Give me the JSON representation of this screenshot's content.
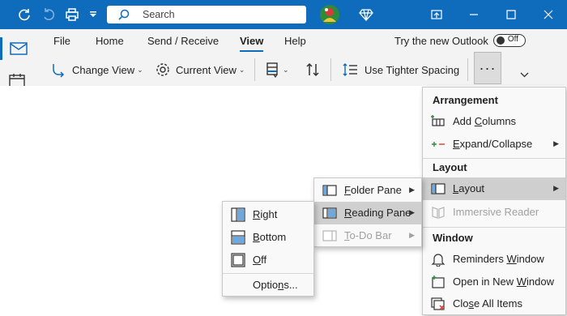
{
  "search": {
    "label": "Search"
  },
  "ribbon": {
    "tabs": [
      "File",
      "Home",
      "Send / Receive",
      "View",
      "Help"
    ],
    "active_tab": "View",
    "try_new": "Try the new Outlook",
    "toggle_state": "Off",
    "change_view": "Change View",
    "current_view": "Current View",
    "tighter_spacing": "Use Tighter Spacing",
    "more": "···"
  },
  "main_menu": {
    "arrangement_header": "Arrangement",
    "add_columns": {
      "pre": "Add ",
      "u": "C",
      "post": "olumns"
    },
    "expand_collapse": {
      "pre": "",
      "u": "E",
      "post": "xpand/Collapse"
    },
    "layout_header": "Layout",
    "layout": {
      "pre": "",
      "u": "L",
      "post": "ayout"
    },
    "immersive_reader": "Immersive Reader",
    "window_header": "Window",
    "reminders_window": {
      "pre": "Reminders ",
      "u": "W",
      "post": "indow"
    },
    "open_new_window": {
      "pre": "Open in New ",
      "u": "W",
      "post": "indow"
    },
    "close_all_items": {
      "pre": "Clo",
      "u": "s",
      "post": "e All Items"
    }
  },
  "layout_menu": {
    "folder_pane": {
      "pre": "",
      "u": "F",
      "post": "older Pane"
    },
    "reading_pane": {
      "pre": "",
      "u": "R",
      "post": "eading Pane"
    },
    "todo_bar": {
      "pre": "",
      "u": "T",
      "post": "o-Do Bar"
    }
  },
  "reading_menu": {
    "right": {
      "pre": "",
      "u": "R",
      "post": "ight"
    },
    "bottom": {
      "pre": "",
      "u": "B",
      "post": "ottom"
    },
    "off": {
      "pre": "",
      "u": "O",
      "post": "ff"
    },
    "options": {
      "pre": "Optio",
      "u": "n",
      "post": "s..."
    }
  },
  "colors": {
    "titlebar": "#0f6cbd",
    "ribbon_bg": "#f3f3f3",
    "menu_bg": "#f9f9f9",
    "hover": "#cfcfcf"
  }
}
